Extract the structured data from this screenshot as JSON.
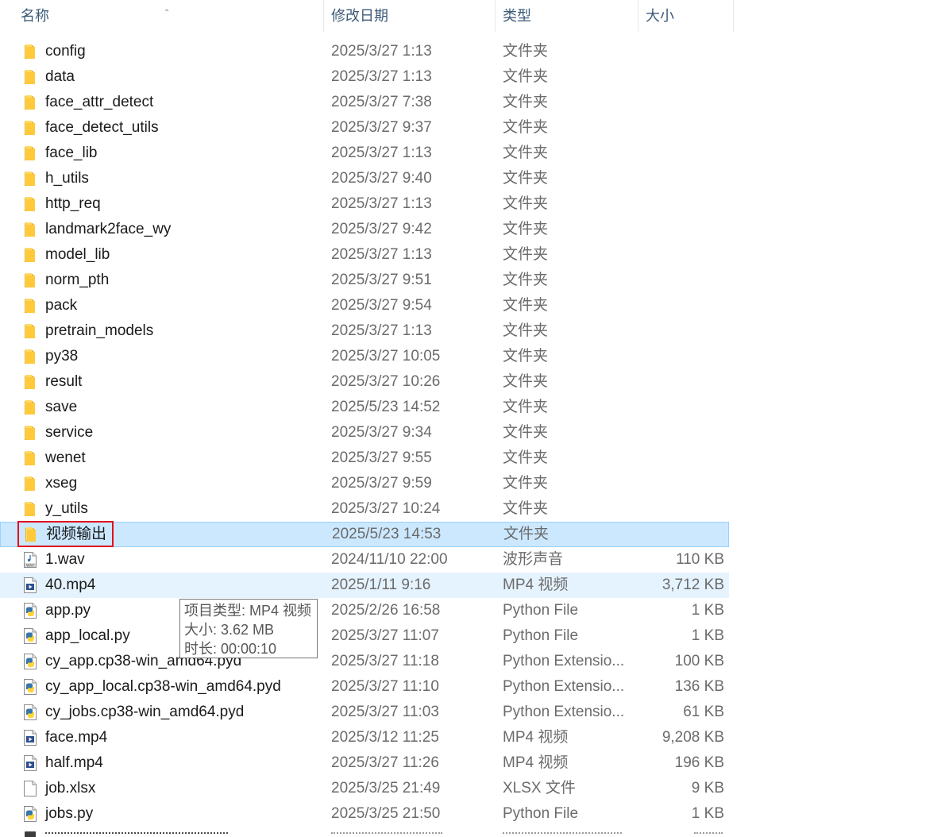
{
  "columns": {
    "name": "名称",
    "modified": "修改日期",
    "type": "类型",
    "size": "大小"
  },
  "files": [
    {
      "name": "config",
      "modified": "2025/3/27 1:13",
      "type": "文件夹",
      "size": "",
      "icon": "folder-icon"
    },
    {
      "name": "data",
      "modified": "2025/3/27 1:13",
      "type": "文件夹",
      "size": "",
      "icon": "folder-icon"
    },
    {
      "name": "face_attr_detect",
      "modified": "2025/3/27 7:38",
      "type": "文件夹",
      "size": "",
      "icon": "folder-icon"
    },
    {
      "name": "face_detect_utils",
      "modified": "2025/3/27 9:37",
      "type": "文件夹",
      "size": "",
      "icon": "folder-icon"
    },
    {
      "name": "face_lib",
      "modified": "2025/3/27 1:13",
      "type": "文件夹",
      "size": "",
      "icon": "folder-icon"
    },
    {
      "name": "h_utils",
      "modified": "2025/3/27 9:40",
      "type": "文件夹",
      "size": "",
      "icon": "folder-icon"
    },
    {
      "name": "http_req",
      "modified": "2025/3/27 1:13",
      "type": "文件夹",
      "size": "",
      "icon": "folder-icon"
    },
    {
      "name": "landmark2face_wy",
      "modified": "2025/3/27 9:42",
      "type": "文件夹",
      "size": "",
      "icon": "folder-icon"
    },
    {
      "name": "model_lib",
      "modified": "2025/3/27 1:13",
      "type": "文件夹",
      "size": "",
      "icon": "folder-icon"
    },
    {
      "name": "norm_pth",
      "modified": "2025/3/27 9:51",
      "type": "文件夹",
      "size": "",
      "icon": "folder-icon"
    },
    {
      "name": "pack",
      "modified": "2025/3/27 9:54",
      "type": "文件夹",
      "size": "",
      "icon": "folder-icon"
    },
    {
      "name": "pretrain_models",
      "modified": "2025/3/27 1:13",
      "type": "文件夹",
      "size": "",
      "icon": "folder-icon"
    },
    {
      "name": "py38",
      "modified": "2025/3/27 10:05",
      "type": "文件夹",
      "size": "",
      "icon": "folder-icon"
    },
    {
      "name": "result",
      "modified": "2025/3/27 10:26",
      "type": "文件夹",
      "size": "",
      "icon": "folder-icon"
    },
    {
      "name": "save",
      "modified": "2025/5/23 14:52",
      "type": "文件夹",
      "size": "",
      "icon": "folder-icon"
    },
    {
      "name": "service",
      "modified": "2025/3/27 9:34",
      "type": "文件夹",
      "size": "",
      "icon": "folder-icon"
    },
    {
      "name": "wenet",
      "modified": "2025/3/27 9:55",
      "type": "文件夹",
      "size": "",
      "icon": "folder-icon"
    },
    {
      "name": "xseg",
      "modified": "2025/3/27 9:59",
      "type": "文件夹",
      "size": "",
      "icon": "folder-icon"
    },
    {
      "name": "y_utils",
      "modified": "2025/3/27 10:24",
      "type": "文件夹",
      "size": "",
      "icon": "folder-icon"
    },
    {
      "name": "视频输出",
      "modified": "2025/5/23 14:53",
      "type": "文件夹",
      "size": "",
      "icon": "folder-icon",
      "state": "selected"
    },
    {
      "name": "1.wav",
      "modified": "2024/11/10 22:00",
      "type": "波形声音",
      "size": "110 KB",
      "icon": "audio-file-icon"
    },
    {
      "name": "40.mp4",
      "modified": "2025/1/11 9:16",
      "type": "MP4 视频",
      "size": "3,712 KB",
      "icon": "video-file-icon",
      "state": "hover"
    },
    {
      "name": "app.py",
      "modified": "2025/2/26 16:58",
      "type": "Python File",
      "size": "1 KB",
      "icon": "python-file-icon"
    },
    {
      "name": "app_local.py",
      "modified": "2025/3/27 11:07",
      "type": "Python File",
      "size": "1 KB",
      "icon": "python-file-icon"
    },
    {
      "name": "cy_app.cp38-win_amd64.pyd",
      "modified": "2025/3/27 11:18",
      "type": "Python Extensio...",
      "size": "100 KB",
      "icon": "python-file-icon"
    },
    {
      "name": "cy_app_local.cp38-win_amd64.pyd",
      "modified": "2025/3/27 11:10",
      "type": "Python Extensio...",
      "size": "136 KB",
      "icon": "python-file-icon"
    },
    {
      "name": "cy_jobs.cp38-win_amd64.pyd",
      "modified": "2025/3/27 11:03",
      "type": "Python Extensio...",
      "size": "61 KB",
      "icon": "python-file-icon"
    },
    {
      "name": "face.mp4",
      "modified": "2025/3/12 11:25",
      "type": "MP4 视频",
      "size": "9,208 KB",
      "icon": "video-file-icon"
    },
    {
      "name": "half.mp4",
      "modified": "2025/3/27 11:26",
      "type": "MP4 视频",
      "size": "196 KB",
      "icon": "video-file-icon"
    },
    {
      "name": "job.xlsx",
      "modified": "2025/3/25 21:49",
      "type": "XLSX 文件",
      "size": "9 KB",
      "icon": "blank-file-icon"
    },
    {
      "name": "jobs.py",
      "modified": "2025/3/25 21:50",
      "type": "Python File",
      "size": "1 KB",
      "icon": "python-file-icon"
    }
  ],
  "tooltip": {
    "line1": "项目类型: MP4 视频",
    "line2": "大小: 3.62 MB",
    "line3": "时长: 00:00:10"
  },
  "colors": {
    "selected_bg": "#cce8ff",
    "selected_border": "#99d1ff",
    "hover_bg": "#e5f3ff",
    "annotation_red": "#e0101e",
    "folder_yellow": "#ffc93c"
  }
}
